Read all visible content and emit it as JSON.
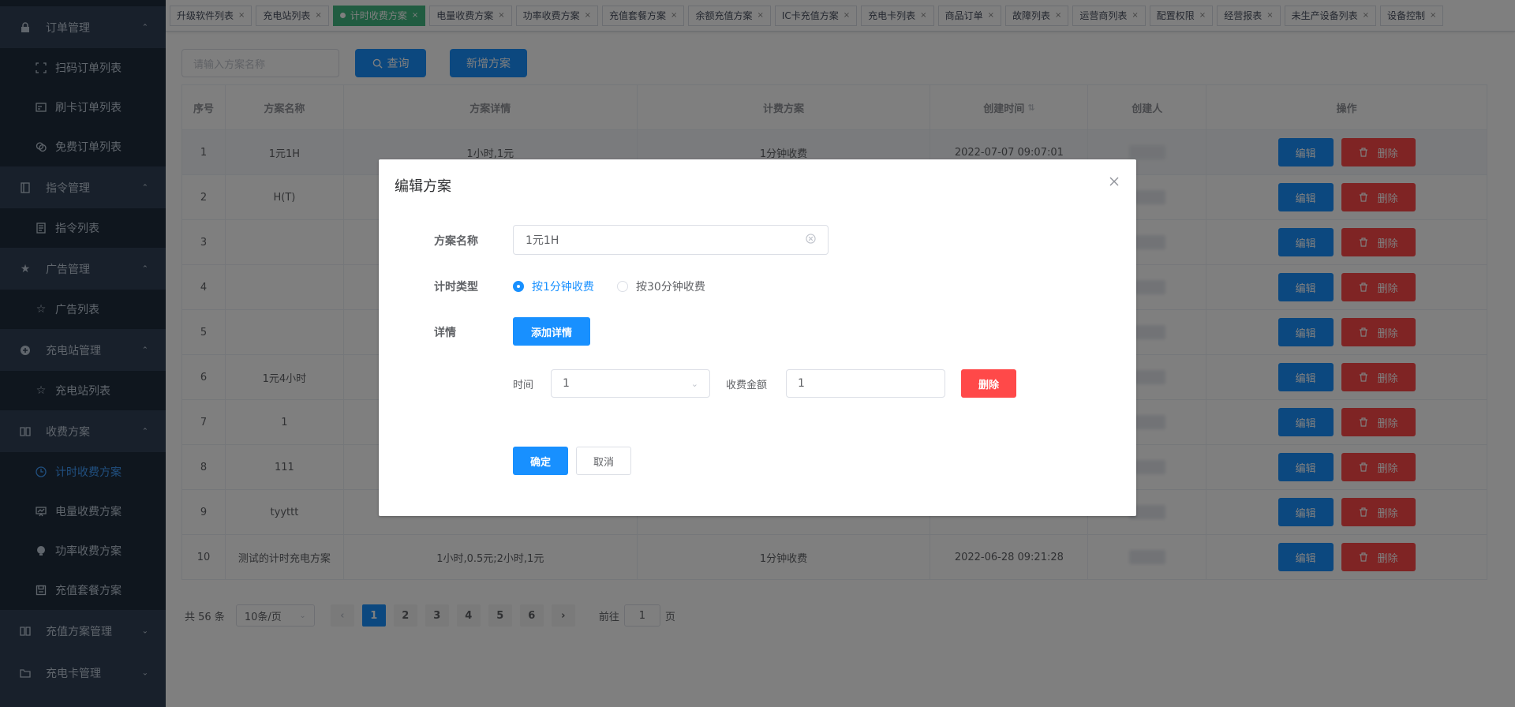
{
  "sidebar": {
    "groups": [
      {
        "label": "订单管理",
        "items": [
          "扫码订单列表",
          "刷卡订单列表",
          "免费订单列表"
        ]
      },
      {
        "label": "指令管理",
        "items": [
          "指令列表"
        ]
      },
      {
        "label": "广告管理",
        "items": [
          "广告列表"
        ]
      },
      {
        "label": "充电站管理",
        "items": [
          "充电站列表"
        ]
      },
      {
        "label": "收费方案",
        "items": [
          "计时收费方案",
          "电量收费方案",
          "功率收费方案",
          "充值套餐方案"
        ]
      },
      {
        "label": "充值方案管理"
      },
      {
        "label": "充电卡管理"
      }
    ]
  },
  "tags": [
    "升级软件列表",
    "充电站列表",
    "计时收费方案",
    "电量收费方案",
    "功率收费方案",
    "充值套餐方案",
    "余额充值方案",
    "IC卡充值方案",
    "充电卡列表",
    "商品订单",
    "故障列表",
    "运营商列表",
    "配置权限",
    "经营报表",
    "未生产设备列表",
    "设备控制"
  ],
  "active_tag_index": 2,
  "toolbar": {
    "search_placeholder": "请输入方案名称",
    "query_label": "查询",
    "add_label": "新增方案"
  },
  "table": {
    "headers": [
      "序号",
      "方案名称",
      "方案详情",
      "计费方案",
      "创建时间",
      "创建人",
      "操作"
    ],
    "rows": [
      {
        "no": "1",
        "name": "1元1H",
        "detail": "1小时,1元",
        "billing": "1分钟收费",
        "created": "2022-07-07 09:07:01"
      },
      {
        "no": "2",
        "name": "H(T)",
        "detail": "",
        "billing": "",
        "created": ""
      },
      {
        "no": "3",
        "name": "",
        "detail": "",
        "billing": "",
        "created": ""
      },
      {
        "no": "4",
        "name": "",
        "detail": "",
        "billing": "",
        "created": ""
      },
      {
        "no": "5",
        "name": "",
        "detail": "",
        "billing": "",
        "created": ""
      },
      {
        "no": "6",
        "name": "1元4小时",
        "detail": "",
        "billing": "",
        "created": ""
      },
      {
        "no": "7",
        "name": "1",
        "detail": "",
        "billing": "",
        "created": ""
      },
      {
        "no": "8",
        "name": "111",
        "detail": "",
        "billing": "",
        "created": ""
      },
      {
        "no": "9",
        "name": "tyyttt",
        "detail": "",
        "billing": "",
        "created": ""
      },
      {
        "no": "10",
        "name": "测试的计时充电方案",
        "detail": "1小时,0.5元;2小时,1元",
        "billing": "1分钟收费",
        "created": "2022-06-28 09:21:28"
      }
    ],
    "edit_label": "编辑",
    "delete_label": "删除"
  },
  "pagination": {
    "total": "共 56 条",
    "page_size": "10条/页",
    "pages": [
      "1",
      "2",
      "3",
      "4",
      "5",
      "6"
    ],
    "current": "1",
    "goto_prefix": "前往",
    "goto_value": "1",
    "goto_suffix": "页"
  },
  "dialog": {
    "title": "编辑方案",
    "name_label": "方案名称",
    "name_value": "1元1H",
    "type_label": "计时类型",
    "type_options": [
      "按1分钟收费",
      "按30分钟收费"
    ],
    "type_selected": "按1分钟收费",
    "detail_label": "详情",
    "add_detail_label": "添加详情",
    "time_label": "时间",
    "time_value": "1",
    "amount_label": "收费金额",
    "amount_value": "1",
    "remove_label": "删除",
    "confirm_label": "确定",
    "cancel_label": "取消"
  },
  "colors": {
    "primary": "#1890ff",
    "danger": "#ff4949",
    "sidebar_bg": "#304156",
    "active_tag": "#42b983"
  }
}
